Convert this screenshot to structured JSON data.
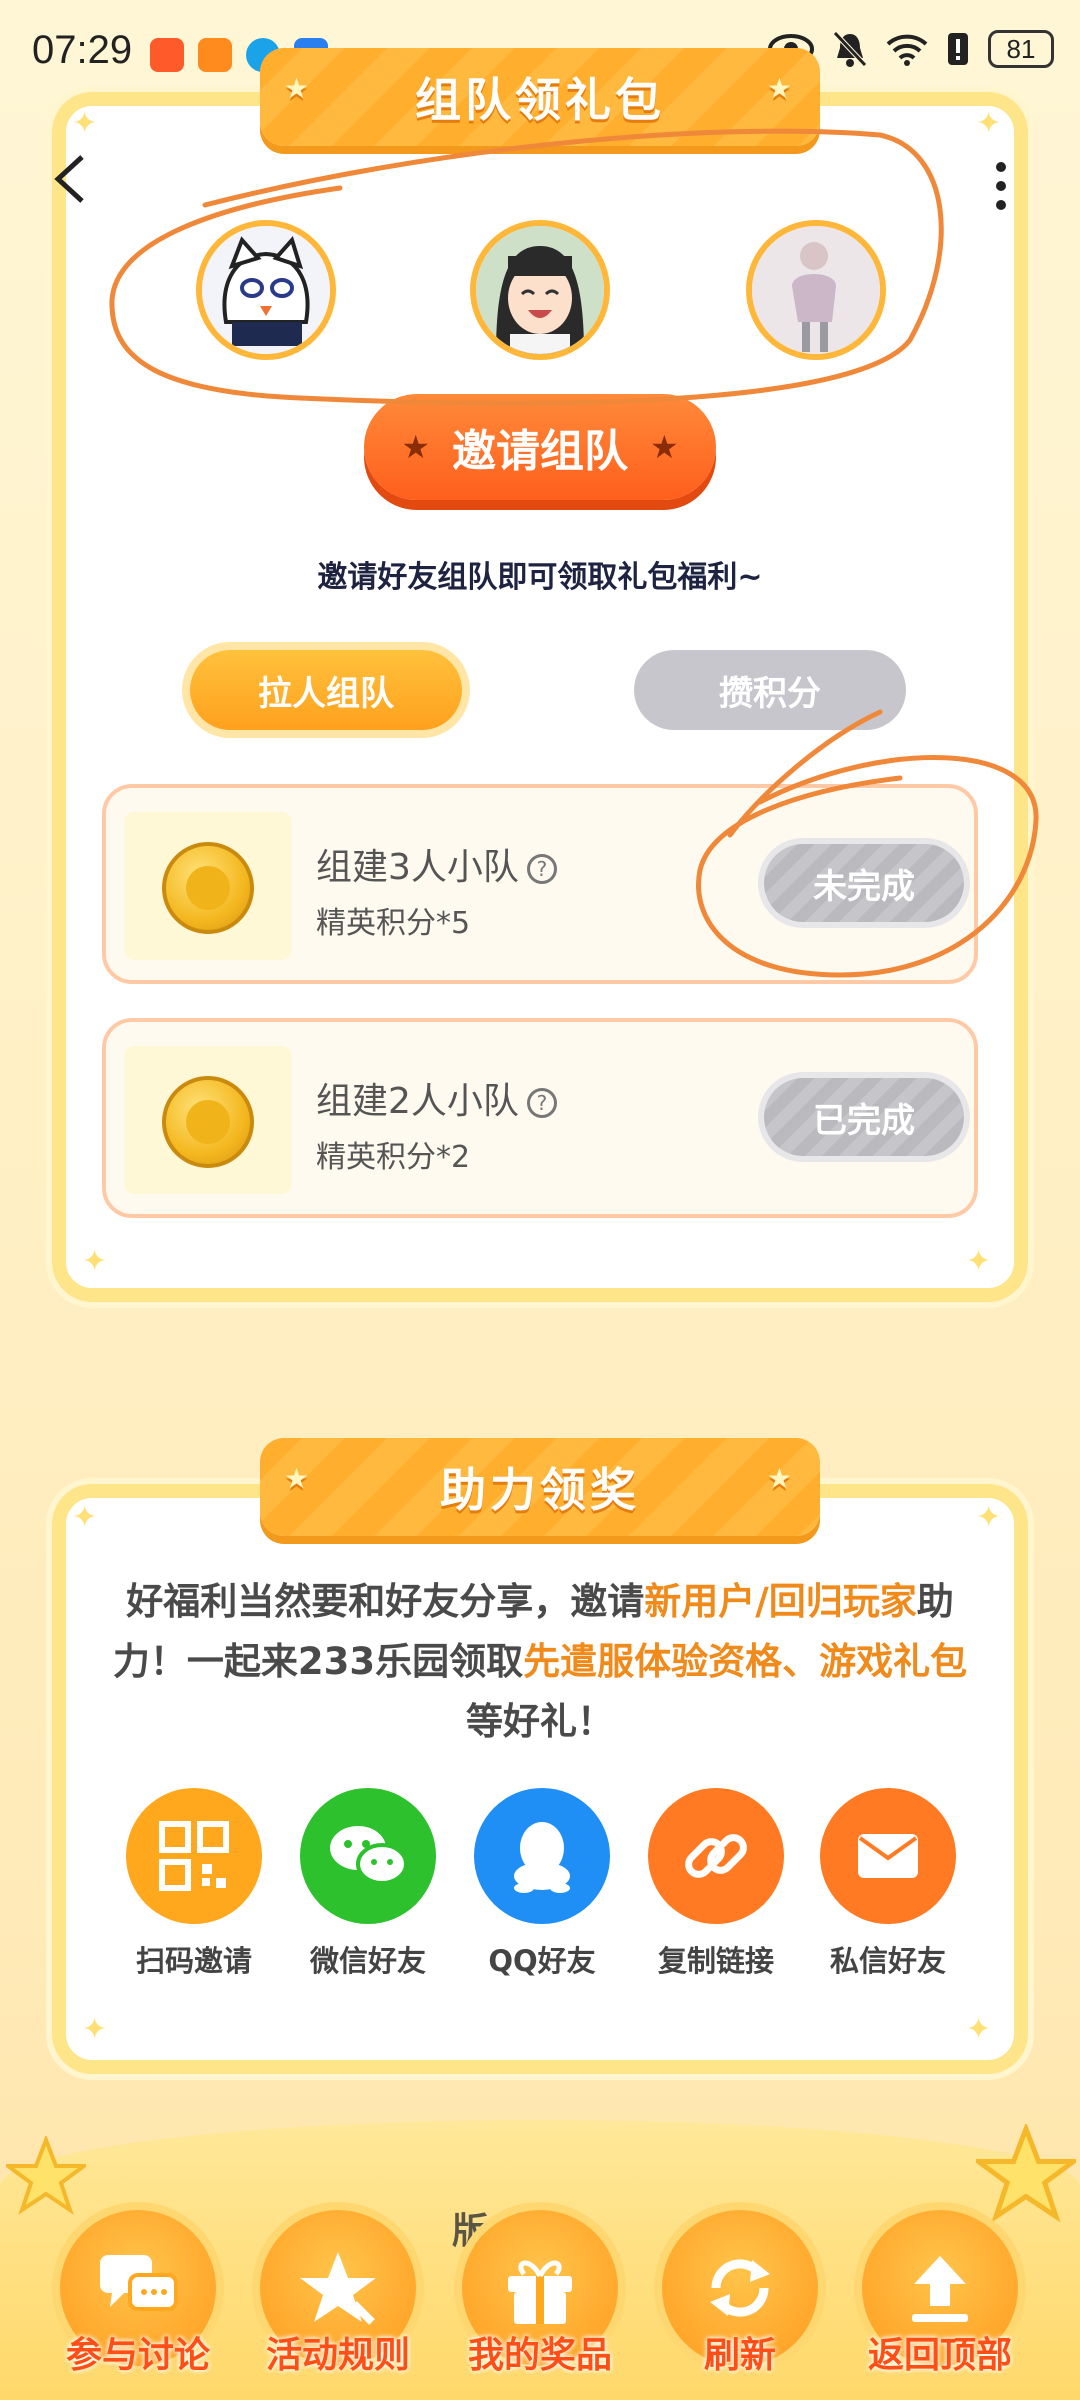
{
  "status_bar": {
    "time": "07:29",
    "battery": "81"
  },
  "team_section": {
    "title": "组队领礼包",
    "invite_button": "邀请组队",
    "invite_subtitle": "邀请好友组队即可领取礼包福利~",
    "tabs": [
      {
        "label": "拉人组队",
        "active": true
      },
      {
        "label": "攒积分",
        "active": false
      }
    ],
    "tasks": [
      {
        "title": "组建3人小队",
        "reward": "精英积分*5",
        "status": "未完成"
      },
      {
        "title": "组建2人小队",
        "reward": "精英积分*2",
        "status": "已完成"
      }
    ],
    "help_glyph": "?"
  },
  "assist_section": {
    "title": "助力领奖",
    "text_1": "好福利当然要和好友分享，邀请",
    "text_hl_1": "新用户/回归玩家",
    "text_2": "助力！一起来233乐园领取",
    "text_hl_2": "先遣服体验资格、游戏礼包",
    "text_3": "等好礼！",
    "share_options": [
      {
        "label": "扫码邀请",
        "color": "#ffa81e",
        "icon": "qr-code-icon"
      },
      {
        "label": "微信好友",
        "color": "#2dc12d",
        "icon": "wechat-icon"
      },
      {
        "label": "QQ好友",
        "color": "#1f8ef5",
        "icon": "qq-icon"
      },
      {
        "label": "复制链接",
        "color": "#ff7a22",
        "icon": "link-icon"
      },
      {
        "label": "私信好友",
        "color": "#ff7a22",
        "icon": "mail-icon"
      }
    ]
  },
  "peek_label": "版   点",
  "bottom_nav": [
    {
      "label": "参与讨论",
      "icon": "chat-bubbles-icon"
    },
    {
      "label": "活动规则",
      "icon": "rules-star-icon"
    },
    {
      "label": "我的奖品",
      "icon": "gift-icon"
    },
    {
      "label": "刷新",
      "icon": "refresh-icon"
    },
    {
      "label": "返回顶部",
      "icon": "back-to-top-icon"
    }
  ],
  "colors": {
    "accent": "#ffa81e",
    "highlight": "#f08a1a",
    "annotation": "#f0883a",
    "nav_label": "#ff4e16"
  }
}
